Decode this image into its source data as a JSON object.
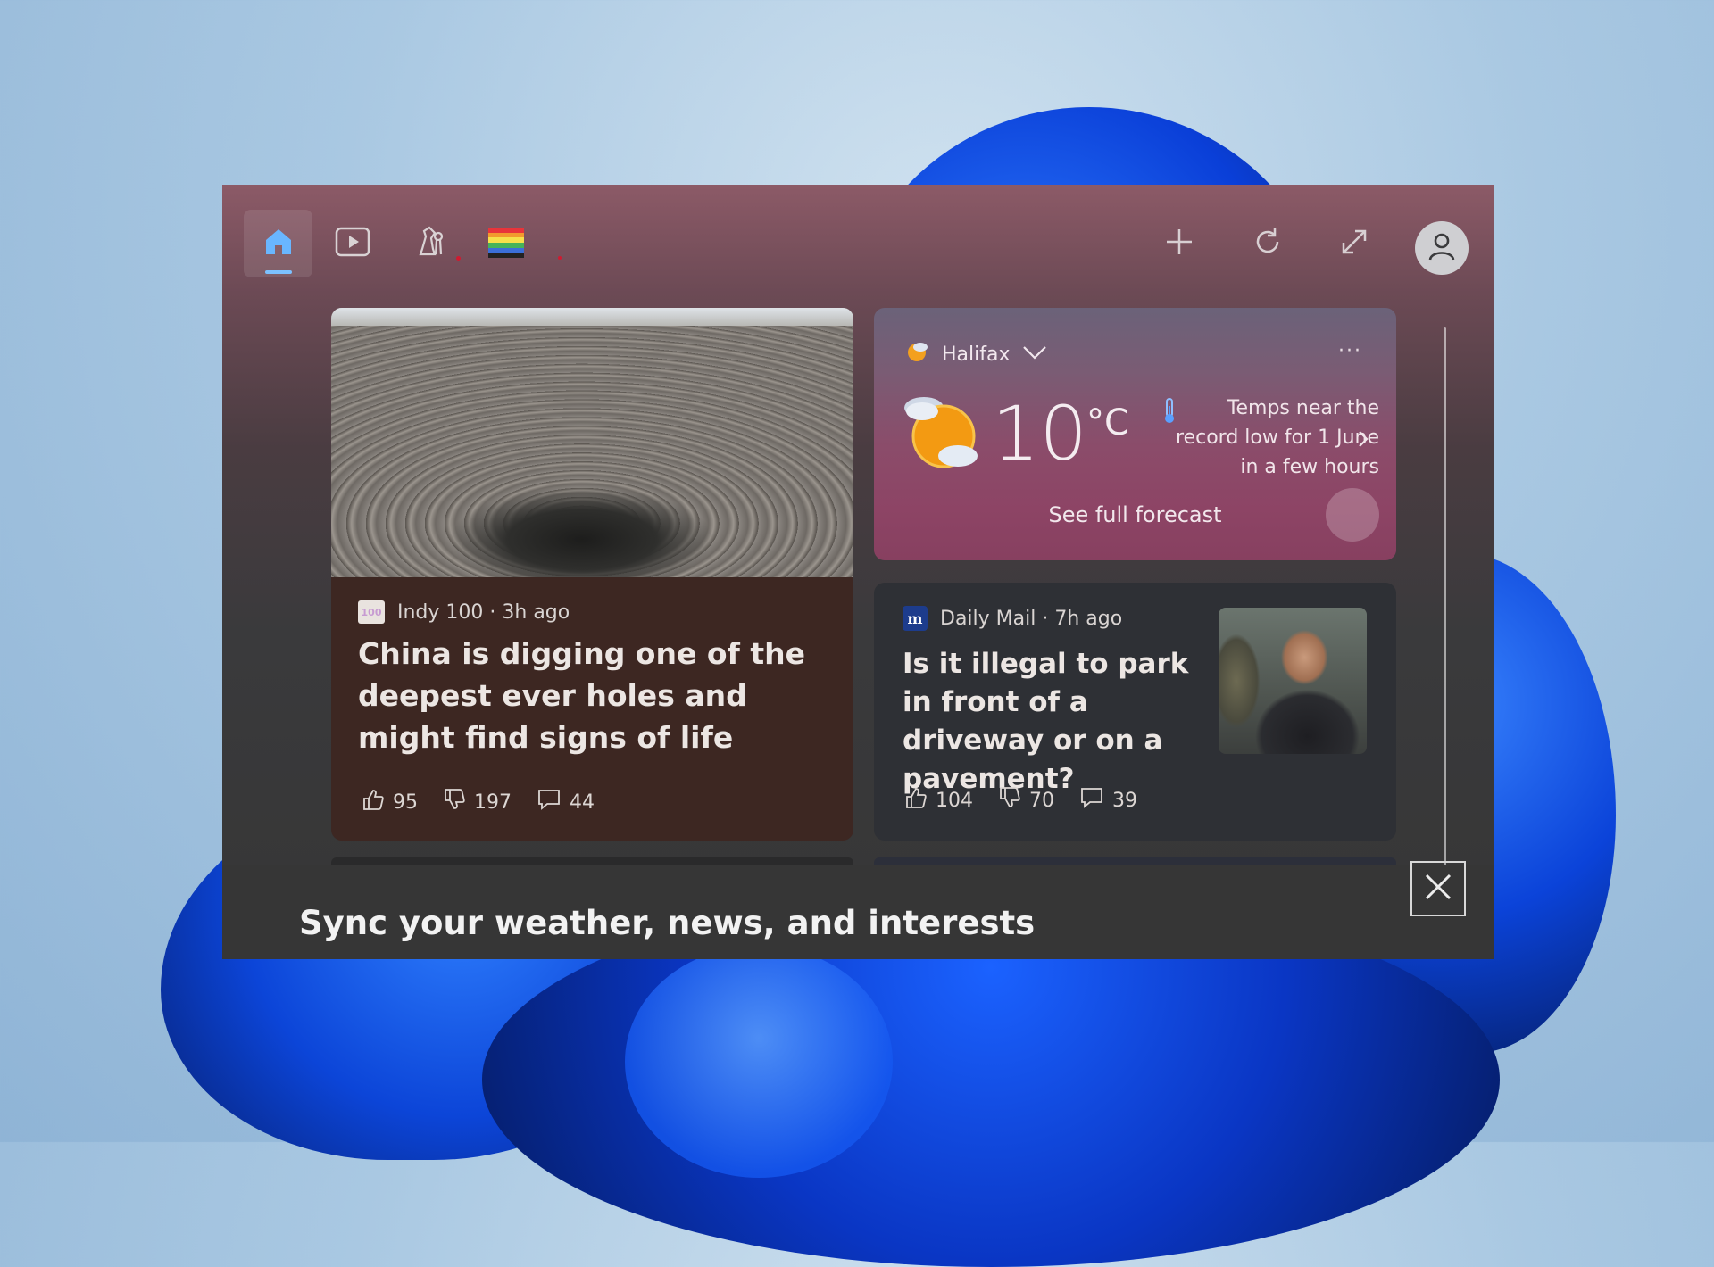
{
  "toolbar": {
    "tabs": [
      {
        "icon": "home-icon",
        "active": true
      },
      {
        "icon": "play-video-icon"
      },
      {
        "icon": "chess-pieces-icon"
      },
      {
        "icon": "rainbow-flag-icon"
      }
    ],
    "actions": [
      "add-icon",
      "refresh-icon",
      "expand-icon",
      "account-icon"
    ]
  },
  "cards": {
    "china": {
      "source_logo": "100",
      "source": "Indy 100 · 3h ago",
      "headline": "China is digging one of the deepest ever holes and might find signs of life",
      "likes": "95",
      "dislikes": "197",
      "comments": "44"
    },
    "weather": {
      "location": "Halifax",
      "more": "···",
      "temperature": "10",
      "unit": "°C",
      "alert": "Temps near the record low for 1 June in a few hours",
      "forecast_link": "See full forecast"
    },
    "dailymail": {
      "source_logo": "m",
      "source": "Daily Mail · 7h ago",
      "headline": "Is it illegal to park in front of a driveway or on a pavement?",
      "likes": "104",
      "dislikes": "70",
      "comments": "39"
    }
  },
  "footer": {
    "text": "Sync your weather, news, and interests"
  },
  "colors": {
    "accent": "#7cc1ff",
    "notification_dot": "#d01a30"
  }
}
